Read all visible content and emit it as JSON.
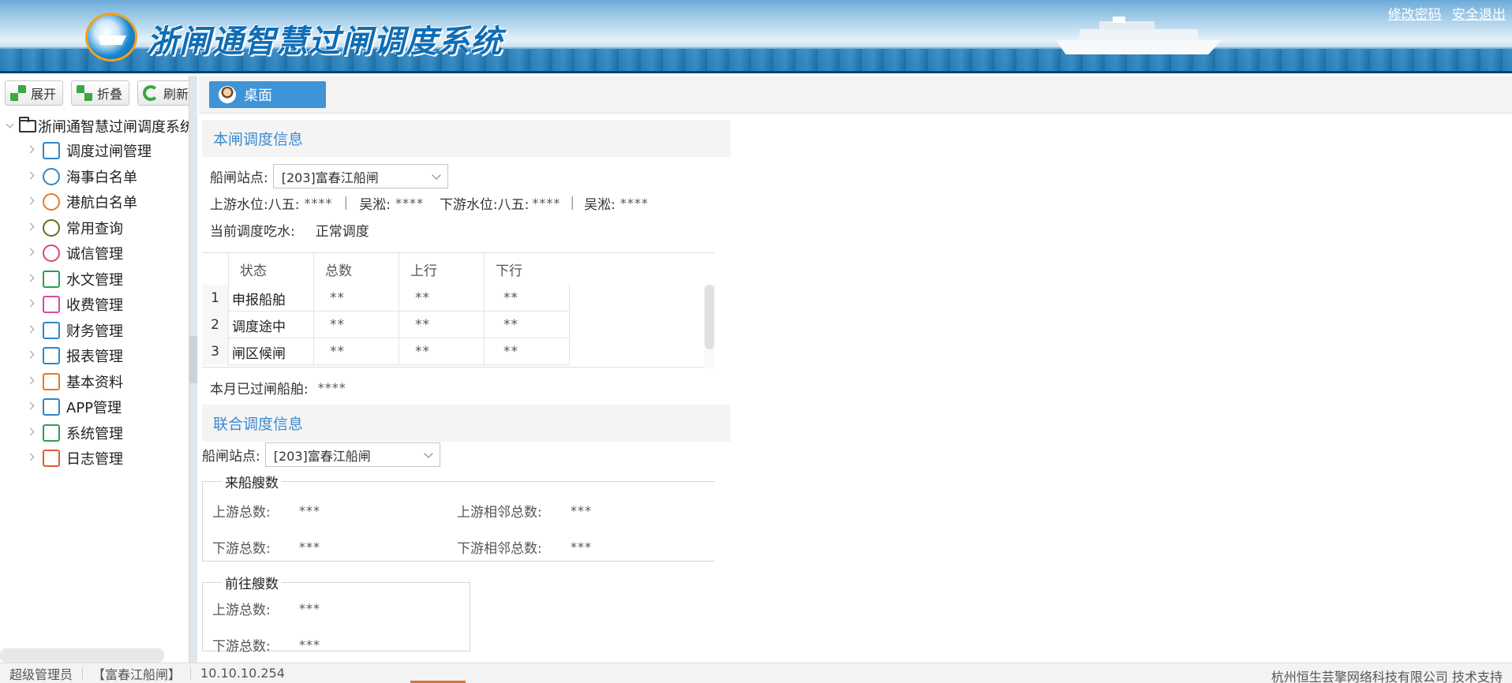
{
  "header": {
    "title": "浙闸通智慧过闸调度系统",
    "links": {
      "change_password": "修改密码",
      "logout": "安全退出"
    }
  },
  "toolbar": {
    "expand": "展开",
    "fold": "折叠",
    "refresh": "刷新"
  },
  "tree": {
    "root": "浙闸通智慧过闸调度系统",
    "items": [
      {
        "label": "调度过闸管理",
        "icon": "schedule-icon"
      },
      {
        "label": "海事白名单",
        "icon": "anchor-icon"
      },
      {
        "label": "港航白名单",
        "icon": "anchor-outline-icon"
      },
      {
        "label": "常用查询",
        "icon": "search-icon"
      },
      {
        "label": "诚信管理",
        "icon": "badge-icon"
      },
      {
        "label": "水文管理",
        "icon": "hydrology-icon"
      },
      {
        "label": "收费管理",
        "icon": "billing-icon"
      },
      {
        "label": "财务管理",
        "icon": "finance-icon"
      },
      {
        "label": "报表管理",
        "icon": "report-icon"
      },
      {
        "label": "基本资料",
        "icon": "database-icon"
      },
      {
        "label": "APP管理",
        "icon": "app-icon"
      },
      {
        "label": "系统管理",
        "icon": "system-gear-icon"
      },
      {
        "label": "日志管理",
        "icon": "calendar-log-icon"
      }
    ]
  },
  "tab": {
    "label": "桌面"
  },
  "local": {
    "heading": "本闸调度信息",
    "station_label": "船闸站点:",
    "station_value": "[203]富春江船闸",
    "upstream_label": "上游水位:",
    "upstream_bawu_label": "八五:",
    "upstream_bawu_value": "****",
    "upstream_wusong_label": "吴淞:",
    "upstream_wusong_value": "****",
    "downstream_label": "下游水位:",
    "downstream_bawu_label": "八五:",
    "downstream_bawu_value": "****",
    "downstream_wusong_label": "吴淞:",
    "downstream_wusong_value": "****",
    "draft_label": "当前调度吃水:",
    "draft_value": "正常调度",
    "table": {
      "headers": [
        "状态",
        "总数",
        "上行",
        "下行"
      ],
      "rows": [
        {
          "num": "1",
          "status": "申报船舶",
          "total": "**",
          "up": "**",
          "down": "**"
        },
        {
          "num": "2",
          "status": "调度途中",
          "total": "**",
          "up": "**",
          "down": "**"
        },
        {
          "num": "3",
          "status": "闸区候闸",
          "total": "**",
          "up": "**",
          "down": "**"
        }
      ]
    },
    "month_label": "本月已过闸船舶:",
    "month_value": "****"
  },
  "joint": {
    "heading": "联合调度信息",
    "station_label": "船闸站点:",
    "station_value": "[203]富春江船闸",
    "incoming": {
      "legend": "来船艘数",
      "up_total_label": "上游总数:",
      "up_total_value": "***",
      "up_adj_label": "上游相邻总数:",
      "up_adj_value": "***",
      "down_total_label": "下游总数:",
      "down_total_value": "***",
      "down_adj_label": "下游相邻总数:",
      "down_adj_value": "***"
    },
    "outgoing": {
      "legend": "前往艘数",
      "up_total_label": "上游总数:",
      "up_total_value": "***",
      "down_total_label": "下游总数:",
      "down_total_value": "***"
    }
  },
  "status": {
    "user": "超级管理员",
    "lock": "【富春江船闸】",
    "ip": "10.10.10.254",
    "support": "杭州恒生芸擎网络科技有限公司 技术支持"
  }
}
